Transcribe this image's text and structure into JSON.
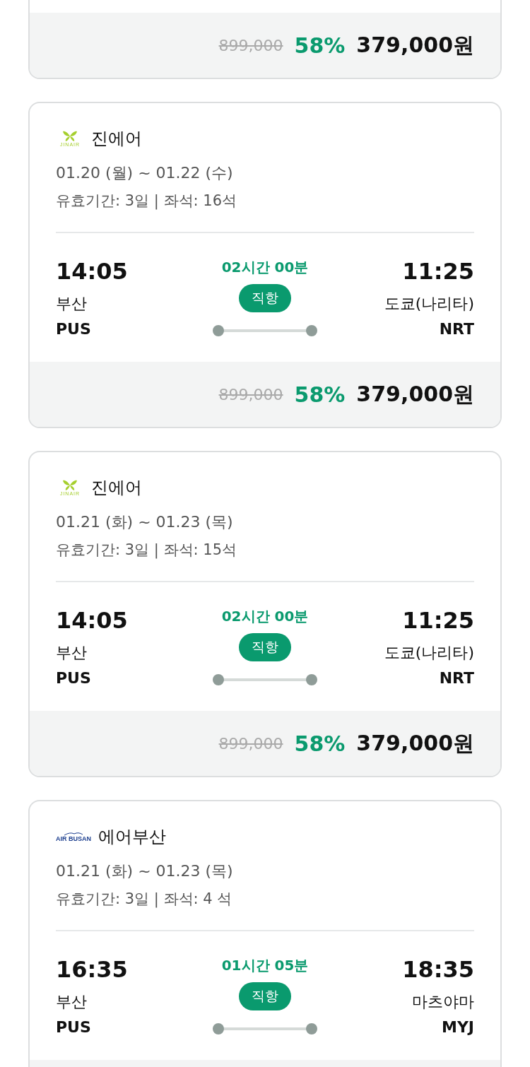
{
  "flights": [
    {
      "price": {
        "original": "899,000",
        "discount": "58%",
        "amount": "379,000원"
      }
    },
    {
      "airline": {
        "kind": "jinair",
        "logo_text": "JINAIR",
        "name": "진에어"
      },
      "dates": "01.20 (월) ~ 01.22 (수)",
      "validity": "유효기간: 3일 | 좌석: 16석",
      "departure": {
        "time": "14:05",
        "city": "부산",
        "code": "PUS"
      },
      "duration": "02시간 00분",
      "route_type": "직항",
      "arrival": {
        "time": "11:25",
        "city": "도쿄(나리타)",
        "code": "NRT"
      },
      "price": {
        "original": "899,000",
        "discount": "58%",
        "amount": "379,000원"
      }
    },
    {
      "airline": {
        "kind": "jinair",
        "logo_text": "JINAIR",
        "name": "진에어"
      },
      "dates": "01.21 (화) ~ 01.23 (목)",
      "validity": "유효기간: 3일 | 좌석: 15석",
      "departure": {
        "time": "14:05",
        "city": "부산",
        "code": "PUS"
      },
      "duration": "02시간 00분",
      "route_type": "직항",
      "arrival": {
        "time": "11:25",
        "city": "도쿄(나리타)",
        "code": "NRT"
      },
      "price": {
        "original": "899,000",
        "discount": "58%",
        "amount": "379,000원"
      }
    },
    {
      "airline": {
        "kind": "airbusan",
        "logo_text": "AIR BUSAN",
        "name": "에어부산"
      },
      "dates": "01.21 (화) ~ 01.23 (목)",
      "validity": "유효기간: 3일 | 좌석: 4 석",
      "departure": {
        "time": "16:35",
        "city": "부산",
        "code": "PUS"
      },
      "duration": "01시간 05분",
      "route_type": "직항",
      "arrival": {
        "time": "18:35",
        "city": "마츠야마",
        "code": "MYJ"
      }
    }
  ]
}
